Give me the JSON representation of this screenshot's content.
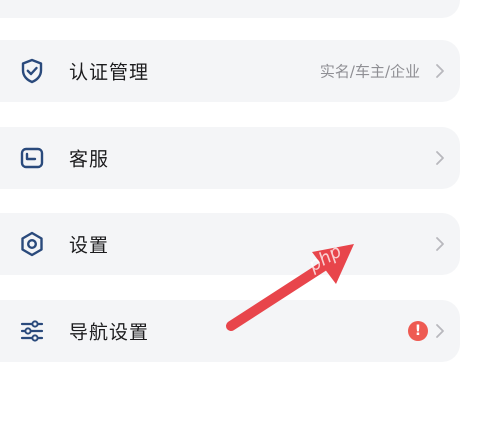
{
  "colors": {
    "card_bg": "#f4f5f7",
    "icon": "#2a4a7c",
    "arrow": "#e8454b",
    "badge": "#ee5a52"
  },
  "menu": {
    "items": [
      {
        "label": "认证管理",
        "sub": "实名/车主/企业",
        "icon": "shield-check-icon"
      },
      {
        "label": "客服",
        "icon": "message-box-icon"
      },
      {
        "label": "设置",
        "icon": "hexagon-gear-icon"
      },
      {
        "label": "导航设置",
        "badge": "!",
        "icon": "sliders-icon"
      }
    ]
  },
  "watermark": "php"
}
